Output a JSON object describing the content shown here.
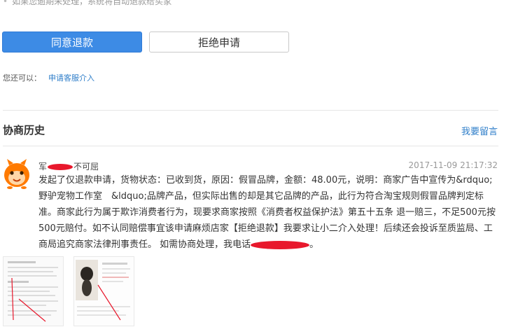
{
  "notice": {
    "text": "如果您逾期未处理，系统将自动退款给买家"
  },
  "actions": {
    "agree_label": "同意退款",
    "reject_label": "拒绝申请"
  },
  "help": {
    "prefix": "您还可以：",
    "link": "申请客服介入"
  },
  "history": {
    "title": "协商历史",
    "leave_message": "我要留言"
  },
  "entry": {
    "user_prefix": "军",
    "user_suffix": "不可屈",
    "timestamp": "2017-11-09 21:17:32",
    "message": "发起了仅退款申请，货物状态：已收到货，原因：假冒品牌，金额：48.00元，说明：商家广告中宣传为&rdquo;野驴宠物工作室　&ldquo;品牌产品，但实际出售的却是其它品牌的产品，此行为符合淘宝规则假冒品牌判定标准。商家此行为属于欺诈消费者行为，现要求商家按照《消费者权益保护法》第五十五条 退一赔三，不足500元按500元赔付。如不认同赔偿事宜该申请麻烦店家【拒绝退款】我要求让小二介入处理！后续还会投诉至质监局、工商局追究商家法律刑事责任。 如需协商处理，我电话",
    "message_end": "。"
  },
  "colors": {
    "accent": "#3d8be5",
    "link": "#2e7ec9",
    "redaction": "#e8182c"
  },
  "icons": {
    "avatar": "orange-mascot-avatar"
  }
}
